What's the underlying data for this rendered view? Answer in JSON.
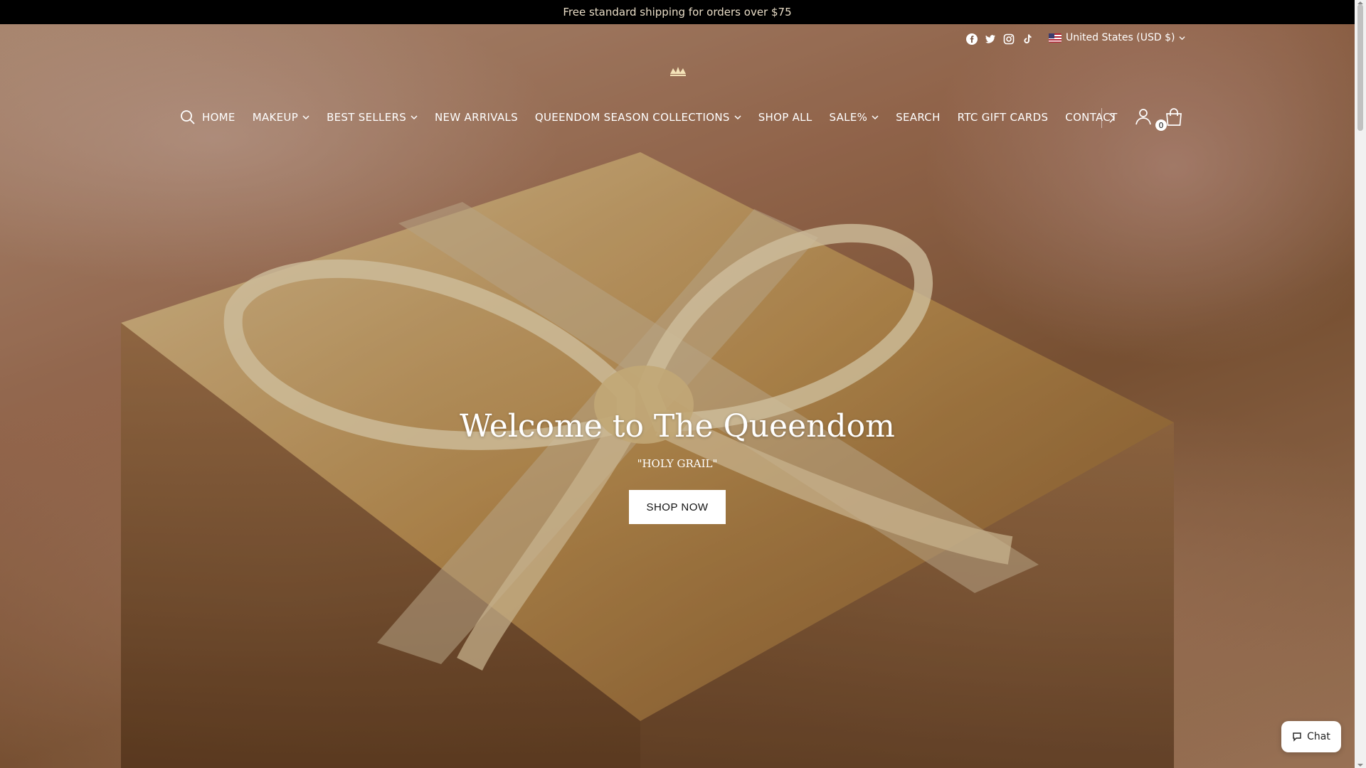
{
  "announcement": {
    "text": "Free standard shipping for orders over $75"
  },
  "header": {
    "social_icons": [
      "facebook-icon",
      "twitter-icon",
      "instagram-icon",
      "tiktok-icon"
    ],
    "locale": {
      "label": "United States (USD $)",
      "flag": "us-flag-icon"
    },
    "nav": [
      {
        "label": "HOME",
        "dropdown": false
      },
      {
        "label": "MAKEUP",
        "dropdown": true
      },
      {
        "label": "BEST SELLERS",
        "dropdown": true
      },
      {
        "label": "NEW ARRIVALS",
        "dropdown": false
      },
      {
        "label": "QUEENDOM SEASON COLLECTIONS",
        "dropdown": true
      },
      {
        "label": "SHOP ALL",
        "dropdown": false
      },
      {
        "label": "SALE%",
        "dropdown": true
      },
      {
        "label": "SEARCH",
        "dropdown": false
      },
      {
        "label": "RTC GIFT CARDS",
        "dropdown": false
      },
      {
        "label": "CONTACT",
        "dropdown": false
      }
    ],
    "cart_count": "0"
  },
  "hero": {
    "title": "Welcome to The Queendom",
    "subtitle": "\"HOLY GRAIL\"",
    "button_label": "SHOP NOW"
  },
  "chat": {
    "label": "Chat"
  },
  "colors": {
    "announcement_bg": "#000000",
    "text_light": "#ffffff",
    "button_bg": "#ffffff"
  }
}
